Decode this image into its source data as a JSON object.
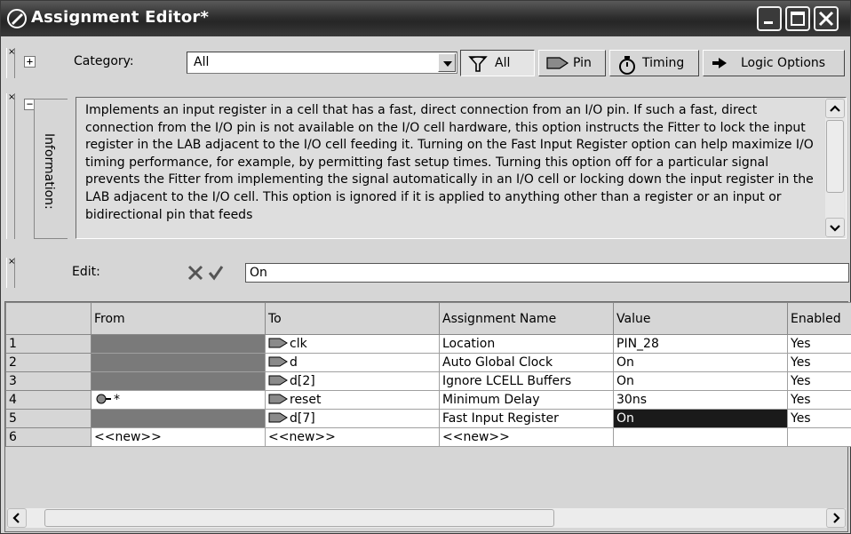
{
  "window": {
    "title": "Assignment Editor*"
  },
  "category_bar": {
    "label": "Category:",
    "selected_category": "All",
    "buttons": [
      {
        "label": "All",
        "icon": "all-filter-icon"
      },
      {
        "label": "Pin",
        "icon": "pin-icon"
      },
      {
        "label": "Timing",
        "icon": "stopwatch-icon"
      },
      {
        "label": "Logic Options",
        "icon": "arrow-icon"
      }
    ]
  },
  "information": {
    "tab_label": "Information:",
    "text": "Implements an input register in a cell that has a fast, direct connection from an I/O pin. If such a fast, direct connection from the I/O pin is not available on the I/O cell hardware, this option instructs the Fitter to lock the input register in the LAB adjacent to the I/O cell feeding it. Turning on the Fast Input Register option can help maximize I/O timing performance, for example, by permitting fast setup times. Turning this option off for a particular signal prevents the Fitter from implementing the signal automatically in an I/O cell or locking down the input register in the LAB adjacent to the I/O cell. This option is ignored if it is applied to anything other than a register or an input or bidirectional pin that feeds"
  },
  "edit_bar": {
    "label": "Edit:",
    "value": "On"
  },
  "grid": {
    "columns": [
      "",
      "From",
      "To",
      "Assignment Name",
      "Value",
      "Enabled"
    ],
    "rows": [
      {
        "num": "1",
        "from": "",
        "to": "clk",
        "assignment": "Location",
        "value": "PIN_28",
        "enabled": "Yes"
      },
      {
        "num": "2",
        "from": "",
        "to": "d",
        "assignment": "Auto Global Clock",
        "value": "On",
        "enabled": "Yes"
      },
      {
        "num": "3",
        "from": "",
        "to": "d[2]",
        "assignment": "Ignore LCELL Buffers",
        "value": "On",
        "enabled": "Yes"
      },
      {
        "num": "4",
        "from": "*",
        "to": "reset",
        "assignment": "Minimum Delay",
        "value": "30ns",
        "enabled": "Yes"
      },
      {
        "num": "5",
        "from": "",
        "to": "d[7]",
        "assignment": "Fast Input Register",
        "value": "On",
        "enabled": "Yes"
      },
      {
        "num": "6",
        "from": "<<new>>",
        "to": "<<new>>",
        "assignment": "<<new>>",
        "value": "",
        "enabled": ""
      }
    ]
  },
  "colors": {
    "titlebar": "#2e2e2e",
    "selected_cell": "#1a1a1a",
    "from_shaded": "#7a7a7a"
  }
}
